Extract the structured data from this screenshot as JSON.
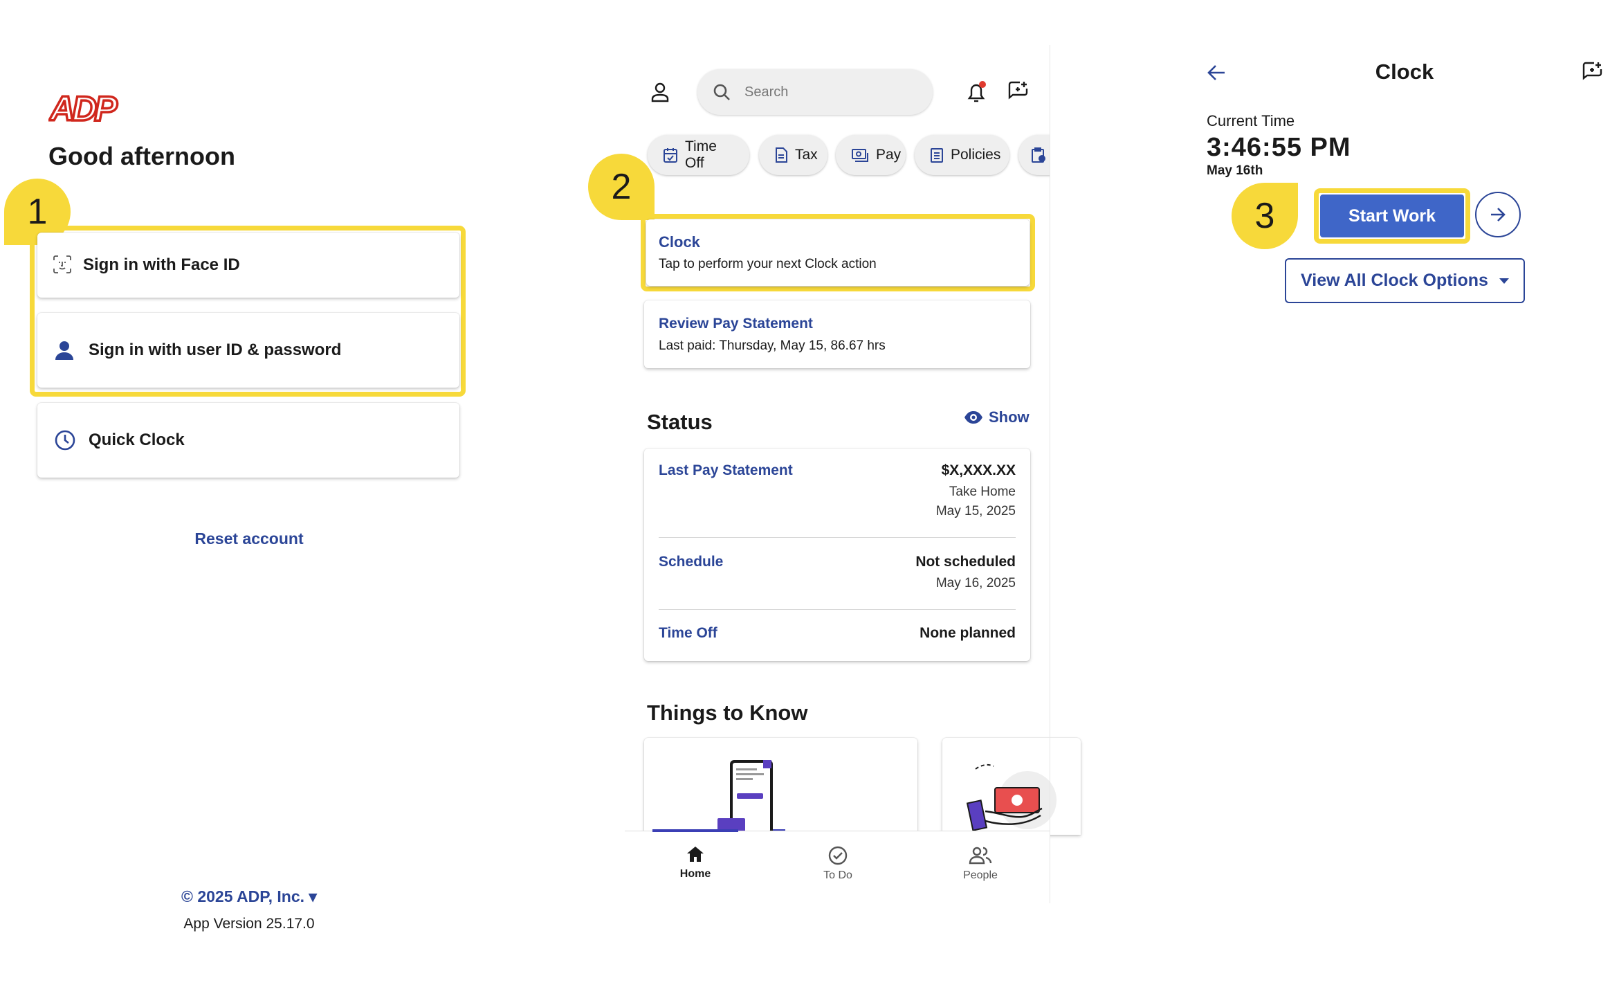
{
  "login": {
    "logo_text": "ADP",
    "greeting": "Good afternoon",
    "callout_number": "1",
    "face_id_label": "Sign in with Face ID",
    "user_password_label": "Sign in with user ID & password",
    "quick_clock_label": "Quick Clock",
    "reset_label": "Reset account",
    "copyright": "© 2025 ADP, Inc. ▾",
    "app_version": "App Version 25.17.0"
  },
  "home": {
    "search_placeholder": "Search",
    "chips": [
      {
        "label": "Time Off",
        "icon": "calendar-icon"
      },
      {
        "label": "Tax",
        "icon": "document-icon"
      },
      {
        "label": "Pay",
        "icon": "pay-icon"
      },
      {
        "label": "Policies",
        "icon": "policies-icon"
      }
    ],
    "callout_number": "2",
    "clock_card": {
      "title": "Clock",
      "subtitle": "Tap to perform your next Clock action"
    },
    "pay_card": {
      "title": "Review Pay Statement",
      "subtitle": "Last paid: Thursday, May 15, 86.67 hrs"
    },
    "status_heading": "Status",
    "show_label": "Show",
    "status_rows": [
      {
        "label": "Last Pay Statement",
        "value": "$X,XXX.XX",
        "sub1": "Take Home",
        "sub2": "May 15, 2025"
      },
      {
        "label": "Schedule",
        "value": "Not scheduled",
        "sub1": "May 16, 2025"
      },
      {
        "label": "Time Off",
        "value": "None planned"
      }
    ],
    "things_heading": "Things to Know",
    "nav": [
      {
        "label": "Home",
        "icon": "home-icon",
        "active": true
      },
      {
        "label": "To Do",
        "icon": "check-circle-icon",
        "active": false
      },
      {
        "label": "People",
        "icon": "people-icon",
        "active": false
      }
    ]
  },
  "clock": {
    "title": "Clock",
    "current_time_label": "Current Time",
    "time": "3:46:55 PM",
    "date": "May 16th",
    "callout_number": "3",
    "start_work_label": "Start Work",
    "view_options_label": "View All Clock Options"
  },
  "colors": {
    "accent": "#2b4597",
    "highlight": "#f7d93a",
    "button": "#3f66c8",
    "logo": "#d0271d"
  }
}
